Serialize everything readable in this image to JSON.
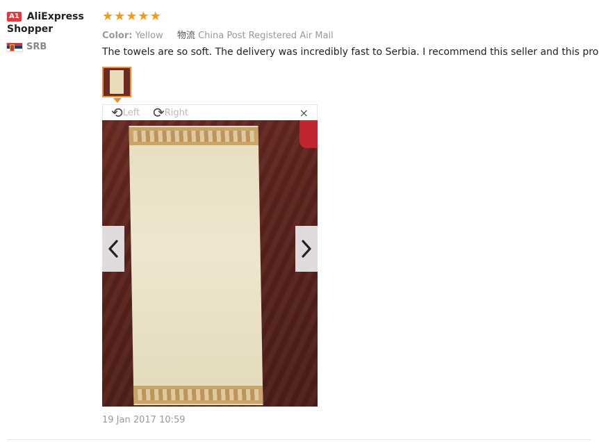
{
  "user": {
    "level_badge": "A1",
    "name_line1": "AliExpress",
    "name_line2": "Shopper",
    "country_code": "SRB"
  },
  "rating": {
    "stars": 5,
    "star_glyph": "★",
    "color": "#f39c12"
  },
  "attributes": {
    "color_label": "Color:",
    "color_value": "Yellow",
    "logistics_label": "物流",
    "logistics_value": "China Post Registered Air Mail"
  },
  "review": {
    "text": "The towels are so soft. The delivery was incredibly fast to Serbia. I recommend this seller and this product.",
    "date": "19 Jan 2017 10:59"
  },
  "viewer": {
    "rotate_left_label": "Left",
    "rotate_right_label": "Right",
    "close_glyph": "×",
    "rotate_left_icon": "rotate-left-icon",
    "rotate_right_icon": "rotate-right-icon"
  },
  "colors": {
    "accent_orange": "#f48d2a",
    "badge_red": "#e4393c"
  }
}
